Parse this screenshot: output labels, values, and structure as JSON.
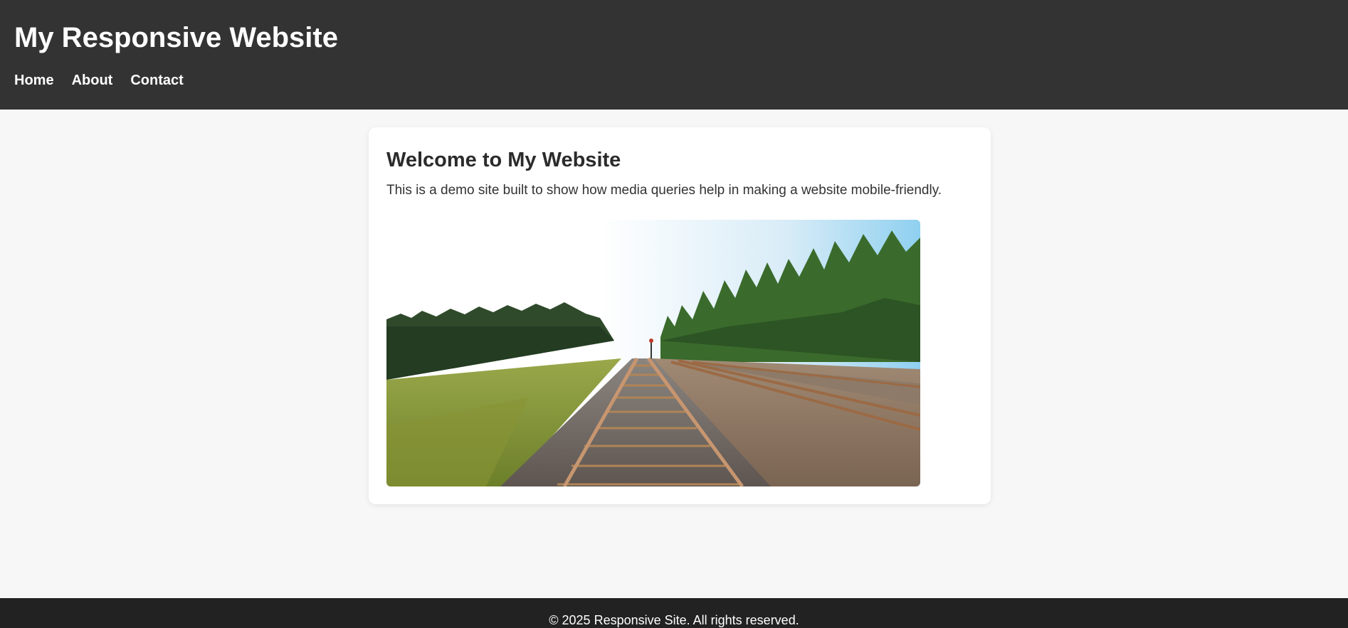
{
  "header": {
    "title": "My Responsive Website",
    "nav": [
      {
        "label": "Home"
      },
      {
        "label": "About"
      },
      {
        "label": "Contact"
      }
    ]
  },
  "main": {
    "heading": "Welcome to My Website",
    "description": "This is a demo site built to show how media queries help in making a website mobile-friendly.",
    "image": {
      "subject": "railway tracks through forest"
    }
  },
  "footer": {
    "text": "© 2025 Responsive Site. All rights reserved."
  },
  "colors": {
    "header_bg": "#333333",
    "footer_bg": "#222222",
    "page_bg": "#f7f7f7",
    "card_bg": "#ffffff"
  }
}
